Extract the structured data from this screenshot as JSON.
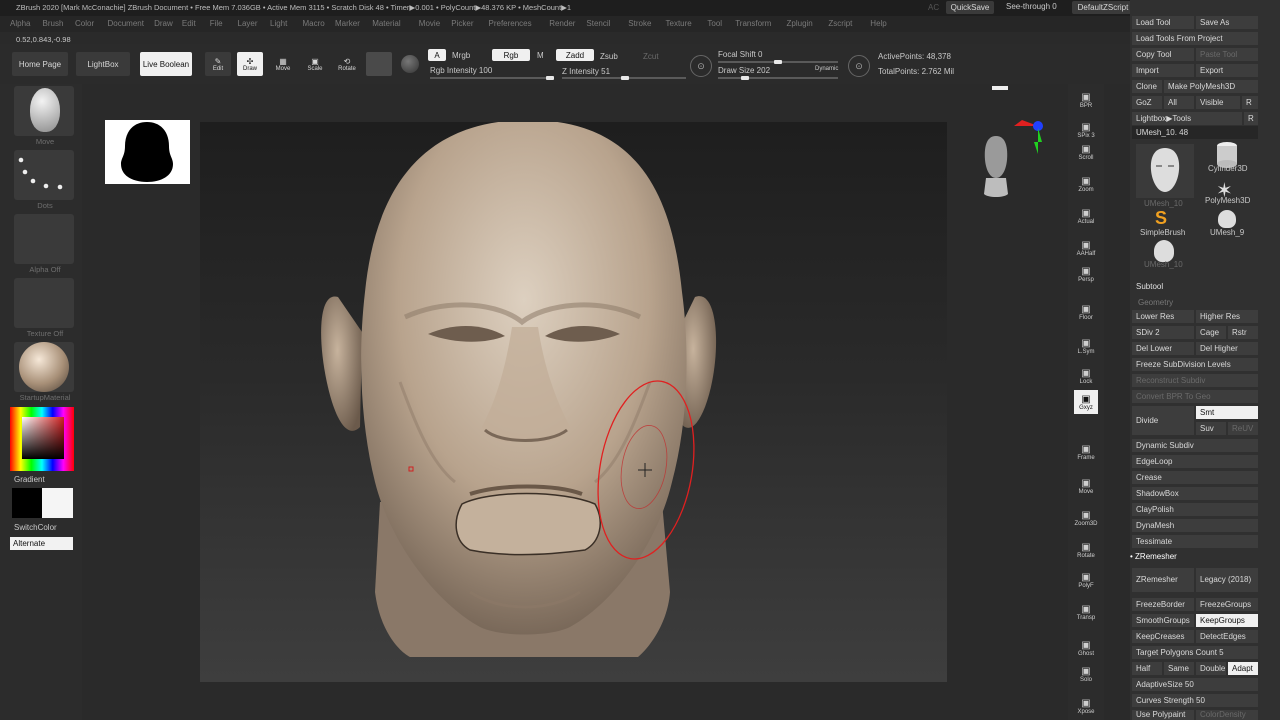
{
  "titlebar": {
    "text": "ZBrush 2020 [Mark McConachie]   ZBrush Document    • Free Mem 7.036GB • Active Mem 3115 • Scratch Disk 48 • Timer▶0.001 • PolyCount▶48.376 KP • MeshCount▶1",
    "ac": "AC",
    "quicksave": "QuickSave",
    "seethrough": "See-through  0",
    "script": "DefaultZScript"
  },
  "menu": [
    "Alpha",
    "Brush",
    "Color",
    "Document",
    "Draw",
    "Edit",
    "File",
    "Layer",
    "Light",
    "Macro",
    "Marker",
    "Material",
    "Movie",
    "Picker",
    "Preferences",
    "Render",
    "Stencil",
    "Stroke",
    "Texture",
    "Tool",
    "Transform",
    "Zplugin",
    "Zscript",
    "Help"
  ],
  "coord": "0.52,0.843,-0.98",
  "toolbar": {
    "home": "Home Page",
    "lightbox": "LightBox",
    "liveboolean": "Live Boolean",
    "edit": "Edit",
    "draw": "Draw",
    "move": "Move",
    "scale": "Scale",
    "rotate": "Rotate",
    "a": "A",
    "mrgb": "Mrgb",
    "rgb": "Rgb",
    "m": "M",
    "zadd": "Zadd",
    "zsub": "Zsub",
    "zcut": "Zcut",
    "rgb_intensity": "Rgb Intensity 100",
    "z_intensity": "Z Intensity 51",
    "focal_shift": "Focal Shift 0",
    "draw_size": "Draw Size 202",
    "dynamic": "Dynamic",
    "active_points": "ActivePoints: 48,378",
    "total_points": "TotalPoints: 2.762 Mil",
    "rgb_intensity_value": 100,
    "z_intensity_value": 51,
    "focal_shift_value": 0,
    "draw_size_value": 202
  },
  "left": {
    "move": "Move",
    "dots": "Dots",
    "alpha": "Alpha Off",
    "texture": "Texture Off",
    "material": "StartupMaterial",
    "gradient": "Gradient",
    "switch": "SwitchColor",
    "alternate": "Alternate"
  },
  "right_shelf": [
    "BPR",
    "SPix 3",
    "Scroll",
    "Zoom",
    "Actual",
    "AAHalf",
    "Persp",
    "Floor",
    "L.Sym",
    "Lock",
    "Gxyz",
    "Frame",
    "Move",
    "Zoom3D",
    "Rotate",
    "PolyF",
    "Transp",
    "Ghost",
    "Solo",
    "Xpose"
  ],
  "tray": {
    "load_tool": "Load Tool",
    "save_as": "Save As",
    "load_proj": "Load Tools From Project",
    "copy_tool": "Copy Tool",
    "paste_tool": "Paste Tool",
    "import": "Import",
    "export": "Export",
    "clone": "Clone",
    "make_poly": "Make PolyMesh3D",
    "goz": "GoZ",
    "all": "All",
    "visible": "Visible",
    "r": "R",
    "lightbox_tools": "Lightbox▶Tools",
    "umesh": "UMesh_10. 48",
    "tools": [
      "UMesh_10",
      "Cylinder3D",
      "PolyMesh3D",
      "SimpleBrush",
      "UMesh_9",
      "UMesh_10"
    ],
    "subtool": "Subtool",
    "geometry": "Geometry",
    "lower_res": "Lower Res",
    "higher_res": "Higher Res",
    "sdiv": "SDiv 2",
    "cage": "Cage",
    "rstr": "Rstr",
    "del_lower": "Del Lower",
    "del_higher": "Del Higher",
    "freeze_sub": "Freeze SubDivision Levels",
    "reconstruct": "Reconstruct Subdiv",
    "convert_bpr": "Convert BPR To Geo",
    "divide": "Divide",
    "smt": "Smt",
    "suv": "Suv",
    "reuv": "ReUV",
    "dynamic_subdiv": "Dynamic Subdiv",
    "edgeloop": "EdgeLoop",
    "crease": "Crease",
    "shadowbox": "ShadowBox",
    "claypolish": "ClayPolish",
    "dynamesh": "DynaMesh",
    "tessimate": "Tessimate",
    "zremesher_h": "• ZRemesher",
    "zremesher": "ZRemesher",
    "legacy": "Legacy (2018)",
    "freezeborder": "FreezeBorder",
    "freezegroups": "FreezeGroups",
    "smoothgroups": "SmoothGroups",
    "keepgroups": "KeepGroups",
    "keepcreases": "KeepCreases",
    "detectedges": "DetectEdges",
    "target": "Target Polygons Count 5",
    "half": "Half",
    "same": "Same",
    "double": "Double",
    "adapt": "Adapt",
    "adaptive": "AdaptiveSize 50",
    "curves": "Curves Strength 50",
    "use_polypaint": "Use Polypaint",
    "color_density": "ColorDensity"
  }
}
